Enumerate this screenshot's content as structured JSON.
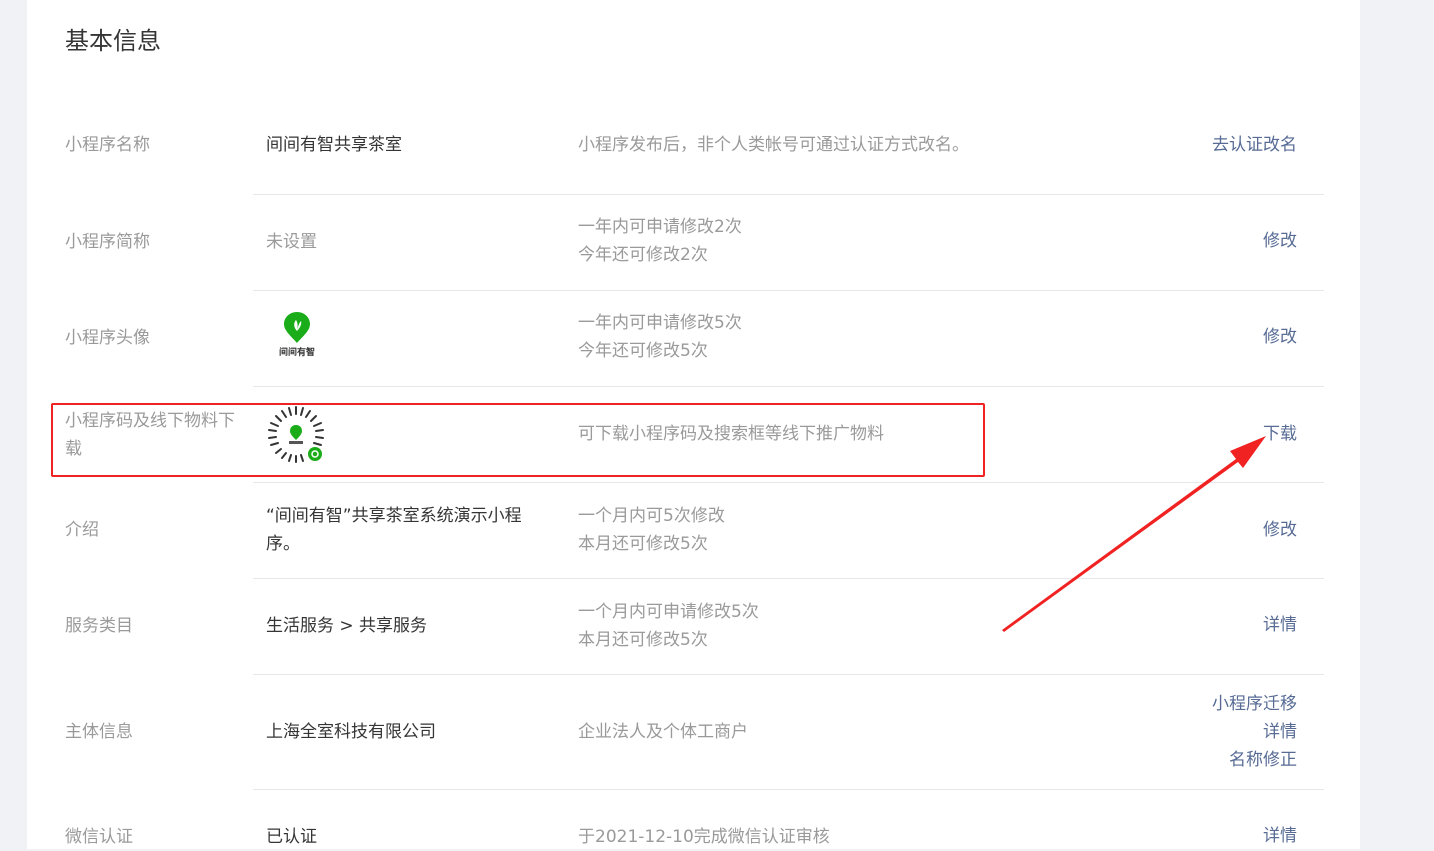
{
  "page": {
    "title": "基本信息"
  },
  "rows": [
    {
      "label": "小程序名称",
      "value": "间间有智共享茶室",
      "desc": [
        "小程序发布后，非个人类帐号可通过认证方式改名。"
      ],
      "actions": [
        "去认证改名"
      ]
    },
    {
      "label": "小程序简称",
      "value": "未设置",
      "desc": [
        "一年内可申请修改2次",
        "今年还可修改2次"
      ],
      "actions": [
        "修改"
      ]
    },
    {
      "label": "小程序头像",
      "value": "",
      "desc": [
        "一年内可申请修改5次",
        "今年还可修改5次"
      ],
      "actions": [
        "修改"
      ]
    },
    {
      "label": "小程序码及线下物料下载",
      "value": "",
      "desc": [
        "可下载小程序码及搜索框等线下推广物料"
      ],
      "actions": [
        "下载"
      ]
    },
    {
      "label": "介绍",
      "value": "“间间有智”共享茶室系统演示小程序。",
      "desc": [
        "一个月内可5次修改",
        "本月还可修改5次"
      ],
      "actions": [
        "修改"
      ]
    },
    {
      "label": "服务类目",
      "value": "生活服务 > 共享服务",
      "desc": [
        "一个月内可申请修改5次",
        "本月还可修改5次"
      ],
      "actions": [
        "详情"
      ]
    },
    {
      "label": "主体信息",
      "value": "上海全室科技有限公司",
      "desc": [
        "企业法人及个体工商户"
      ],
      "actions": [
        "小程序迁移",
        "详情",
        "名称修正"
      ]
    },
    {
      "label": "微信认证",
      "value": "已认证",
      "desc": [
        "于2021-12-10完成微信认证审核"
      ],
      "actions": [
        "详情"
      ]
    }
  ],
  "avatar": {
    "logo_text": "间间有智",
    "icon": "leaf-pin-icon"
  },
  "colors": {
    "link": "#576b95",
    "label": "#9a9a9a",
    "text": "#353535",
    "highlight": "#f02222",
    "brand_green": "#1aad19"
  }
}
